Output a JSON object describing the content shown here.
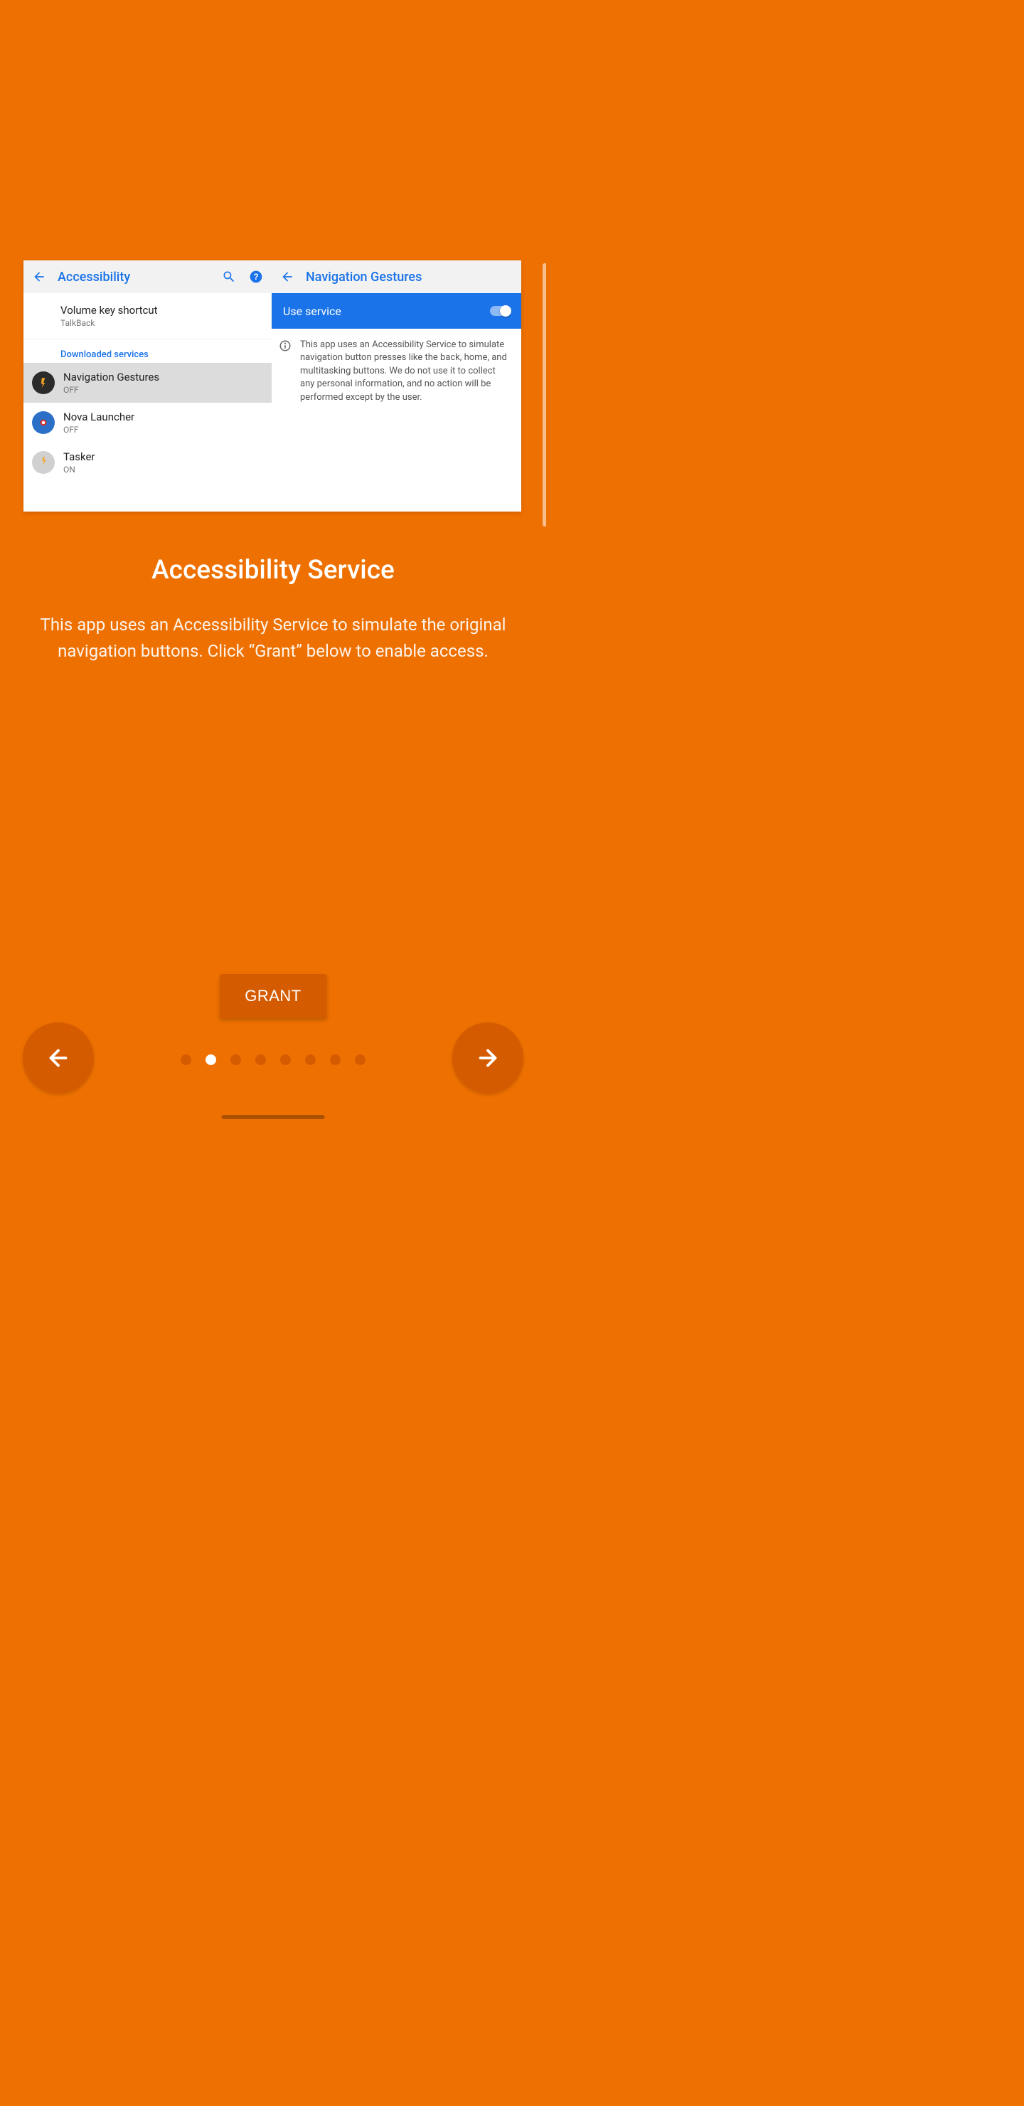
{
  "card": {
    "left": {
      "header": {
        "title": "Accessibility"
      },
      "vks": {
        "title": "Volume key shortcut",
        "sub": "TalkBack"
      },
      "section": "Downloaded services",
      "items": [
        {
          "title": "Navigation Gestures",
          "sub": "OFF"
        },
        {
          "title": "Nova Launcher",
          "sub": "OFF"
        },
        {
          "title": "Tasker",
          "sub": "ON"
        }
      ]
    },
    "right": {
      "header": {
        "title": "Navigation Gestures"
      },
      "use_service": "Use service",
      "info": "This app uses an Accessibility Service to simulate navigation button presses like the back, home, and multitasking buttons. We do not use it to collect any personal information, and no action will be performed except by the user."
    }
  },
  "page": {
    "title": "Accessibility Service",
    "description": "This app uses an Accessibility Service to simulate the original navigation buttons. Click “Grant” below to enable access.",
    "grant": "GRANT"
  },
  "pager": {
    "count": 8,
    "active": 1
  }
}
